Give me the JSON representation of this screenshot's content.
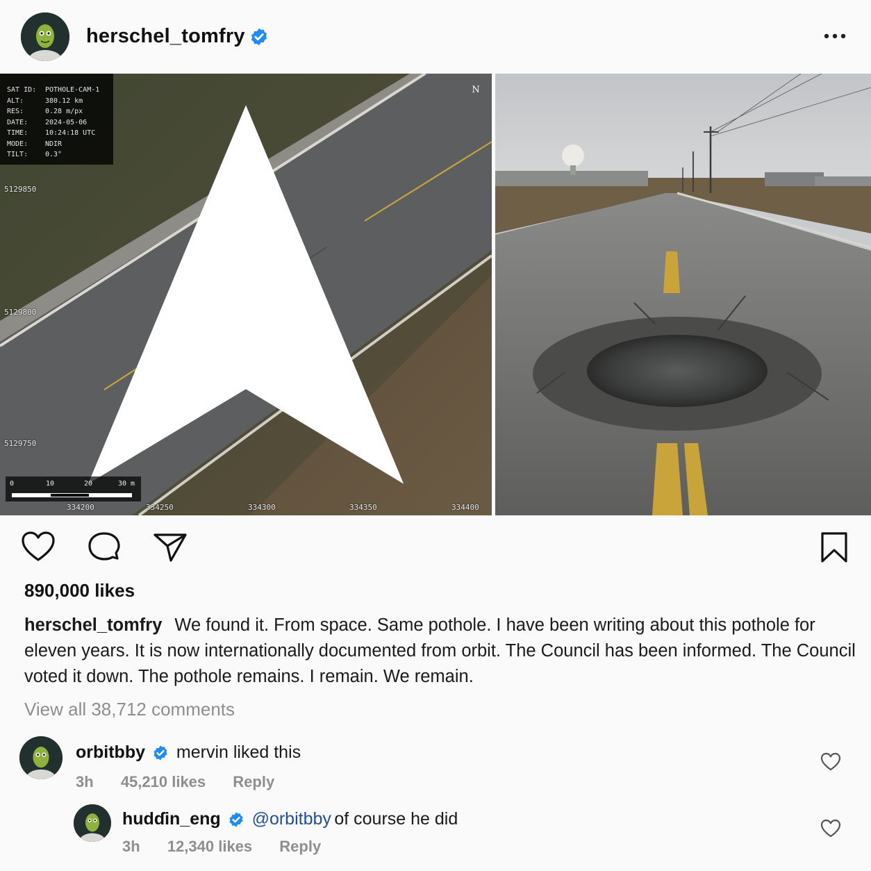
{
  "post": {
    "author": "herschel_tomfry",
    "verified": true,
    "more_icon": "more-horizontal-icon"
  },
  "satellite": {
    "meta": [
      {
        "key": "SAT ID:",
        "value": "POTHOLE-CAM-1"
      },
      {
        "key": "ALT:",
        "value": "380.12 km"
      },
      {
        "key": "RES:",
        "value": "0.28 m/px"
      },
      {
        "key": "DATE:",
        "value": "2024-05-06"
      },
      {
        "key": "TIME:",
        "value": "10:24:18 UTC"
      },
      {
        "key": "MODE:",
        "value": "NDIR"
      },
      {
        "key": "TILT:",
        "value": "0.3°"
      }
    ],
    "northings": [
      "5129850",
      "5129800",
      "5129750"
    ],
    "eastings": [
      "334200",
      "334250",
      "334300",
      "334350",
      "334400"
    ],
    "north_label": "N",
    "scale_labels": [
      "0",
      "10",
      "20",
      "30 m"
    ]
  },
  "actions": {
    "like_icon": "heart-icon",
    "comment_icon": "comment-icon",
    "share_icon": "send-icon",
    "save_icon": "bookmark-icon"
  },
  "likes": "890,000 likes",
  "caption": {
    "user": "herschel_tomfry",
    "text": "We found it. From space. Same pothole. I have been writing about this pothole for eleven years. It is now internationally documented from orbit. The Council has been informed. The Council voted it down. The pothole remains. I remain. We remain."
  },
  "view_comments": "View all 38,712 comments",
  "comments": [
    {
      "user": "orbitbby",
      "verified": true,
      "text": "mervin liked this",
      "time": "3h",
      "likes": "45,210 likes",
      "reply": "Reply"
    },
    {
      "user": "hudɗin_eng",
      "verified": true,
      "mention": "@orbitbby",
      "text": "of course he did",
      "time": "3h",
      "likes": "12,340 likes",
      "reply": "Reply"
    }
  ],
  "colors": {
    "verified": "#1d8cf8",
    "mention": "#1f4f9b",
    "muted": "#8e8e8e",
    "road_line": "#c9a43a"
  }
}
